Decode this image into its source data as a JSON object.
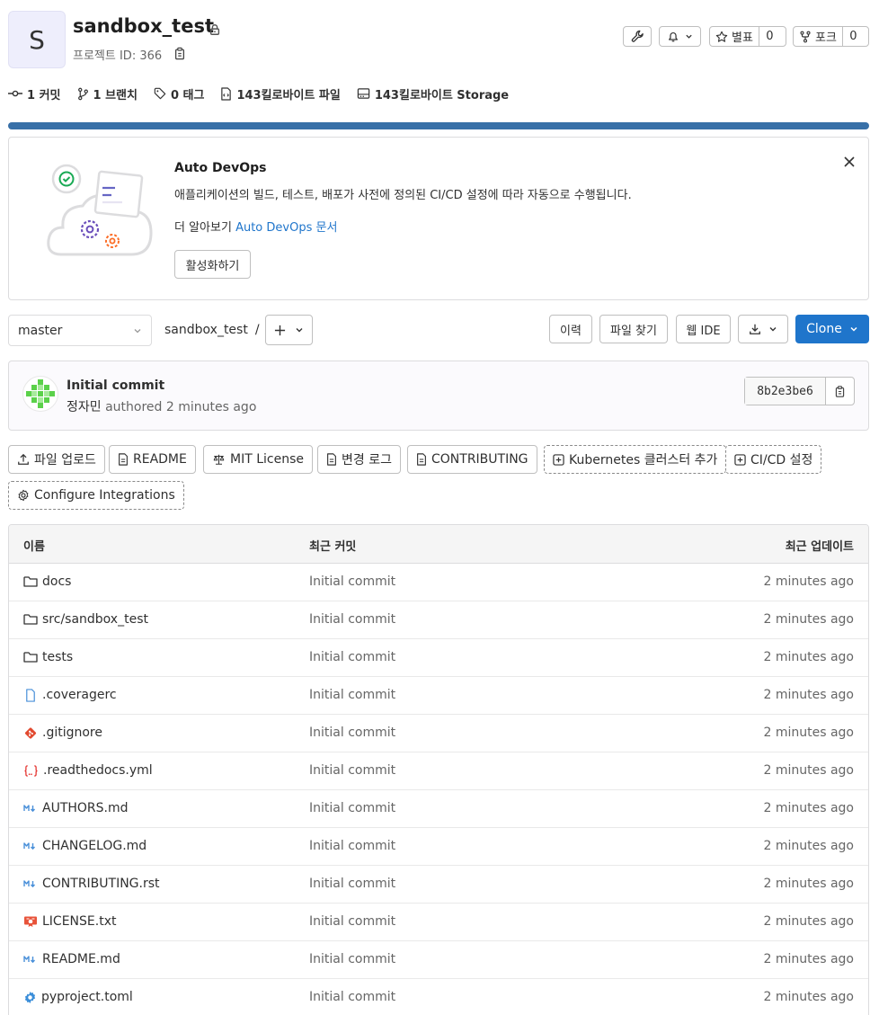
{
  "project": {
    "avatar_letter": "S",
    "name": "sandbox_test",
    "id_label": "프로젝트 ID: 366"
  },
  "header_actions": {
    "star_label": "별표",
    "star_count": "0",
    "fork_label": "포크",
    "fork_count": "0"
  },
  "stats": [
    {
      "icon": "commit-icon",
      "label": "1 커밋"
    },
    {
      "icon": "branch-icon",
      "label": "1 브랜치"
    },
    {
      "icon": "tag-icon",
      "label": "0 태그"
    },
    {
      "icon": "file-icon",
      "label": "143킬로바이트 파일"
    },
    {
      "icon": "storage-icon",
      "label": "143킬로바이트 Storage"
    }
  ],
  "colors": {
    "progress": "#3870a8",
    "primary": "#1f75cb"
  },
  "auto_devops": {
    "title": "Auto DevOps",
    "description": "애플리케이션의 빌드, 테스트, 배포가 사전에 정의된 CI/CD 설정에 따라 자동으로 수행됩니다.",
    "more_prefix": "더 알아보기 ",
    "more_link": "Auto DevOps 문서",
    "enable_button": "활성화하기"
  },
  "repo_nav": {
    "branch": "master",
    "breadcrumb_project": "sandbox_test",
    "breadcrumb_sep": "/",
    "history": "이력",
    "find_file": "파일 찾기",
    "web_ide": "웹 IDE",
    "clone": "Clone"
  },
  "last_commit": {
    "title": "Initial commit",
    "author": "정자민",
    "meta": " authored 2 minutes ago",
    "sha": "8b2e3be6"
  },
  "quick_actions": [
    {
      "label": "파일 업로드",
      "icon": "upload-icon",
      "dashed": false
    },
    {
      "label": "README",
      "icon": "document-icon",
      "dashed": false
    },
    {
      "label": "MIT License",
      "icon": "scale-icon",
      "dashed": false
    },
    {
      "label": "변경 로그",
      "icon": "document-icon",
      "dashed": false
    },
    {
      "label": "CONTRIBUTING",
      "icon": "document-icon",
      "dashed": false
    },
    {
      "label": "Kubernetes 클러스터 추가",
      "icon": "plus-square-icon",
      "dashed": true
    },
    {
      "label": "CI/CD 설정",
      "icon": "plus-square-icon",
      "dashed": true
    },
    {
      "label": "Configure Integrations",
      "icon": "settings-icon",
      "dashed": true
    }
  ],
  "file_table": {
    "headers": {
      "name": "이름",
      "commit": "최근 커밋",
      "updated": "최근 업데이트"
    },
    "rows": [
      {
        "name": "docs",
        "icon": "folder-icon",
        "commit": "Initial commit",
        "updated": "2 minutes ago"
      },
      {
        "name": "src/sandbox_test",
        "icon": "folder-icon",
        "commit": "Initial commit",
        "updated": "2 minutes ago"
      },
      {
        "name": "tests",
        "icon": "folder-icon",
        "commit": "Initial commit",
        "updated": "2 minutes ago"
      },
      {
        "name": ".coveragerc",
        "icon": "file-icon",
        "commit": "Initial commit",
        "updated": "2 minutes ago"
      },
      {
        "name": ".gitignore",
        "icon": "git-icon",
        "commit": "Initial commit",
        "updated": "2 minutes ago"
      },
      {
        "name": ".readthedocs.yml",
        "icon": "yaml-icon",
        "commit": "Initial commit",
        "updated": "2 minutes ago"
      },
      {
        "name": "AUTHORS.md",
        "icon": "markdown-icon",
        "commit": "Initial commit",
        "updated": "2 minutes ago"
      },
      {
        "name": "CHANGELOG.md",
        "icon": "markdown-icon",
        "commit": "Initial commit",
        "updated": "2 minutes ago"
      },
      {
        "name": "CONTRIBUTING.rst",
        "icon": "markdown-icon",
        "commit": "Initial commit",
        "updated": "2 minutes ago"
      },
      {
        "name": "LICENSE.txt",
        "icon": "license-icon",
        "commit": "Initial commit",
        "updated": "2 minutes ago"
      },
      {
        "name": "README.md",
        "icon": "markdown-icon",
        "commit": "Initial commit",
        "updated": "2 minutes ago"
      },
      {
        "name": "pyproject.toml",
        "icon": "gear-icon",
        "commit": "Initial commit",
        "updated": "2 minutes ago"
      }
    ]
  }
}
